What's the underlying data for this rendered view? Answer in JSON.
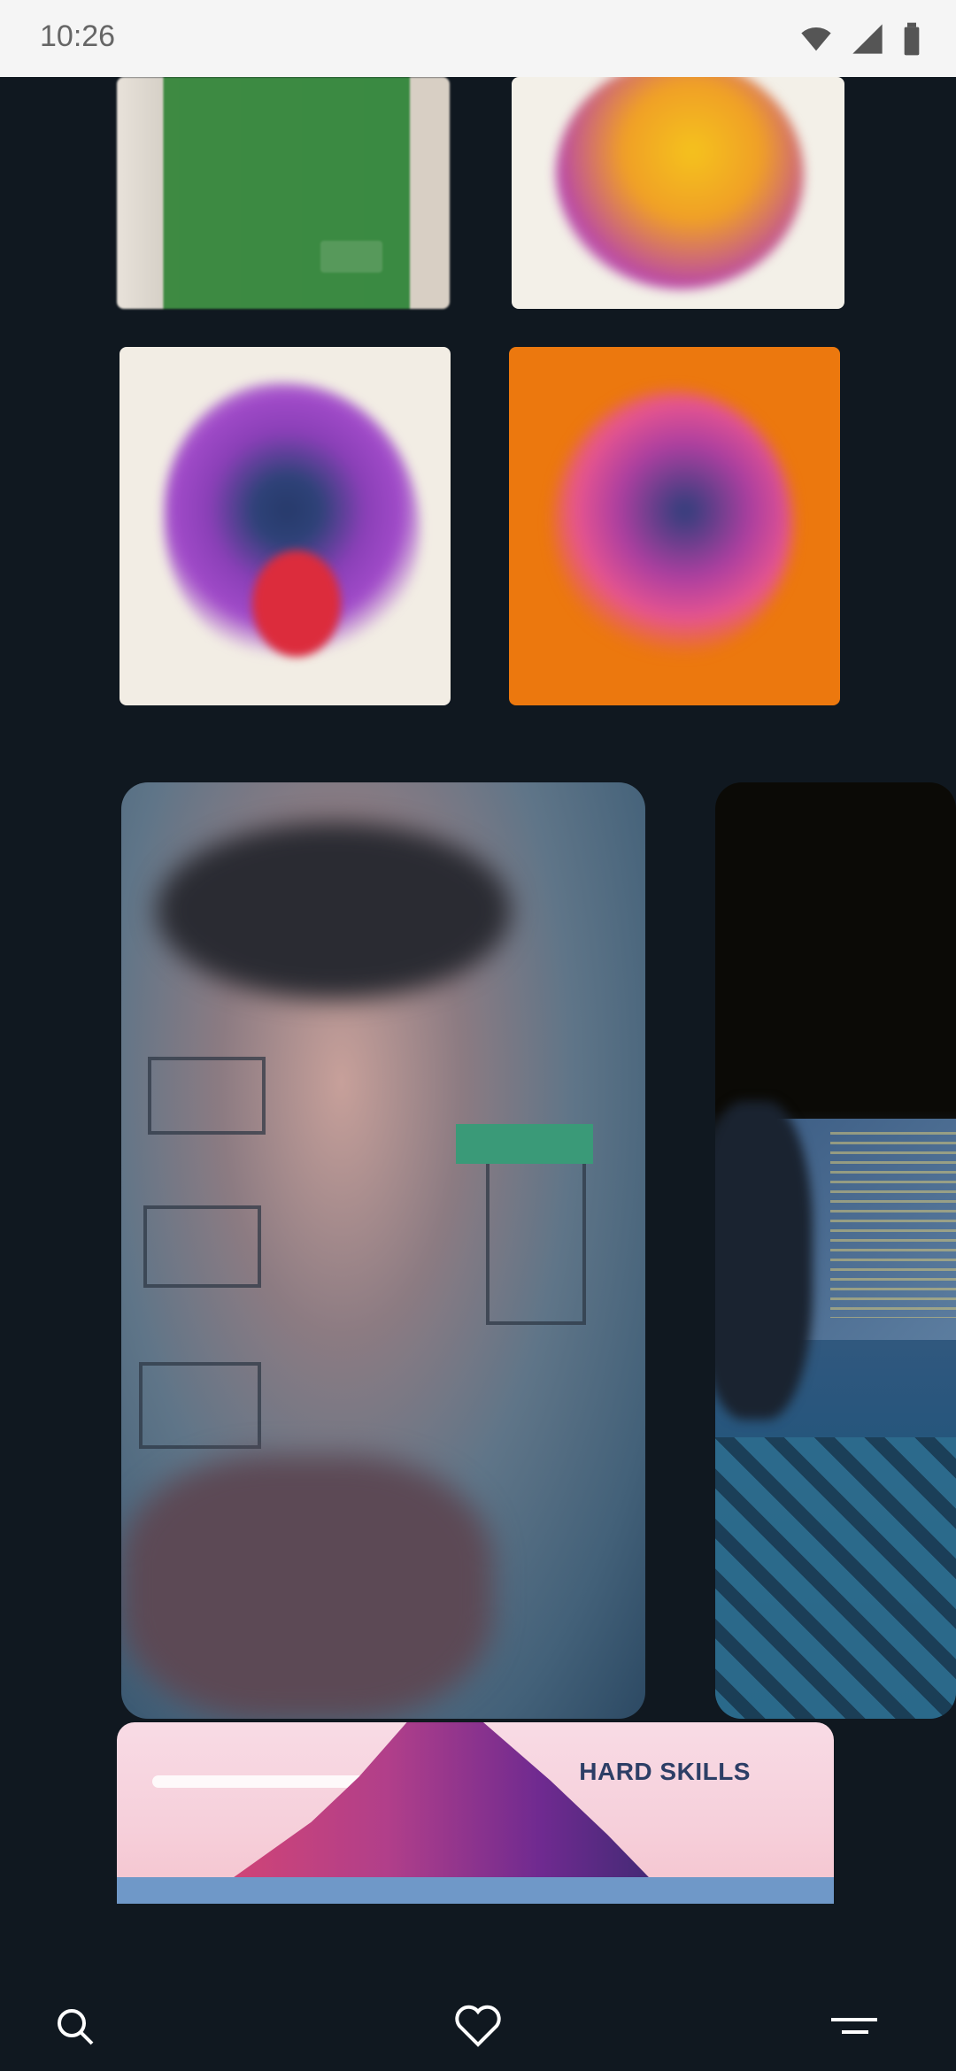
{
  "status_bar": {
    "time": "10:26",
    "icons": [
      "wifi-icon",
      "cell-signal-icon",
      "battery-icon"
    ]
  },
  "banner": {
    "title": "HARD SKILLS"
  },
  "nav": {
    "items": [
      "search-icon",
      "heart-icon",
      "menu-icon"
    ]
  },
  "colors": {
    "background": "#101820",
    "status_bar": "#f5f5f5",
    "banner_title": "#2c3e66"
  }
}
